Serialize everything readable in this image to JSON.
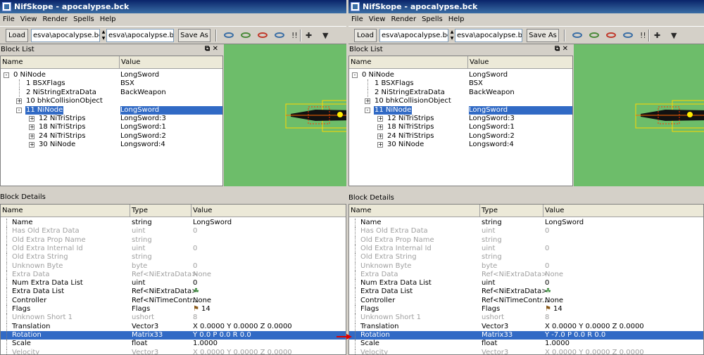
{
  "app": {
    "title": "NifSkope - apocalypse.bck"
  },
  "menu": [
    "File",
    "View",
    "Render",
    "Spells",
    "Help"
  ],
  "toolbar": {
    "load_label": "Load",
    "save_label": "Save As",
    "load_path": "esva\\apocalypse.bck",
    "save_path": "esva\\apocalypse.bck"
  },
  "block_list": {
    "title": "Block List",
    "columns": [
      "Name",
      "Value"
    ],
    "rows": [
      {
        "name": "0  NiNode",
        "value": "LongSword",
        "indent": 0,
        "expander": "-"
      },
      {
        "name": "1  BSXFlags",
        "value": "BSX",
        "indent": 1,
        "expander": ""
      },
      {
        "name": "2  NiStringExtraData",
        "value": "BackWeapon",
        "indent": 1,
        "expander": ""
      },
      {
        "name": "10  bhkCollisionObject",
        "value": "",
        "indent": 1,
        "expander": "+"
      },
      {
        "name": "11  NiNode",
        "value": "LongSword",
        "indent": 1,
        "expander": "-",
        "selected": true
      },
      {
        "name": "12  NiTriStrips",
        "value": "LongSword:3",
        "indent": 2,
        "expander": "+"
      },
      {
        "name": "18  NiTriStrips",
        "value": "LongSword:1",
        "indent": 2,
        "expander": "+"
      },
      {
        "name": "24  NiTriStrips",
        "value": "LongSword:2",
        "indent": 2,
        "expander": "+"
      },
      {
        "name": "30  NiNode",
        "value": "Longsword:4",
        "indent": 2,
        "expander": "+"
      }
    ]
  },
  "block_details": {
    "title": "Block Details",
    "columns": [
      "Name",
      "Type",
      "Value"
    ],
    "rows": [
      {
        "name": "Name",
        "type": "string",
        "value": "LongSword",
        "gray": false
      },
      {
        "name": "Has Old Extra Data",
        "type": "uint",
        "value": "0",
        "gray": true
      },
      {
        "name": "Old Extra Prop Name",
        "type": "string",
        "value": "",
        "gray": true
      },
      {
        "name": "Old Extra Internal Id",
        "type": "uint",
        "value": "0",
        "gray": true
      },
      {
        "name": "Old Extra String",
        "type": "string",
        "value": "",
        "gray": true
      },
      {
        "name": "Unknown Byte",
        "type": "byte",
        "value": "0",
        "gray": true
      },
      {
        "name": "Extra Data",
        "type": "Ref<NiExtraData>",
        "value": "None",
        "gray": true
      },
      {
        "name": "Num Extra Data List",
        "type": "uint",
        "value": "0",
        "gray": false
      },
      {
        "name": "Extra Data List",
        "type": "Ref<NiExtraData>",
        "value": "",
        "gray": false,
        "icon": true
      },
      {
        "name": "Controller",
        "type": "Ref<NiTimeContr...",
        "value": "None",
        "gray": false
      },
      {
        "name": "Flags",
        "type": "Flags",
        "value": "14",
        "gray": false,
        "flag": true
      },
      {
        "name": "Unknown Short 1",
        "type": "ushort",
        "value": "8",
        "gray": true
      },
      {
        "name": "Translation",
        "type": "Vector3",
        "value": "X 0.0000 Y 0.0000 Z 0.0000",
        "gray": false
      },
      {
        "name": "Rotation",
        "type": "Matrix33",
        "value": "",
        "gray": false,
        "selected": true
      },
      {
        "name": "Scale",
        "type": "float",
        "value": "1.0000",
        "gray": false
      },
      {
        "name": "Velocity",
        "type": "Vector3",
        "value": "X 0.0000 Y 0.0000 Z 0.0000",
        "gray": true
      }
    ]
  },
  "panes": [
    {
      "rotation_value": "Y 0.0 P 0.0 R 0.0"
    },
    {
      "rotation_value": "Y -7.0 P 0.0 R 0.0"
    }
  ],
  "colors": {
    "selection": "#316ac5",
    "viewport": "#6dbd6a",
    "arrow": "#e00000"
  }
}
